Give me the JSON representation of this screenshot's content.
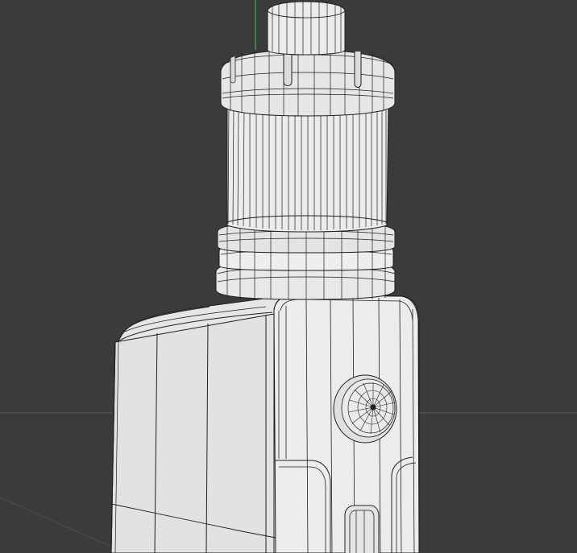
{
  "viewport": {
    "background": "#3b3b3b",
    "grid_color": "#5a5a5a",
    "axis_y_color": "#3fae5f",
    "model_fill": "#e9e9e9",
    "model_shade": "#d8d8d8",
    "wire_color": "#1f1f1f"
  },
  "model": {
    "name": "box-mod-with-atomizer",
    "display": "shaded-wireframe"
  }
}
